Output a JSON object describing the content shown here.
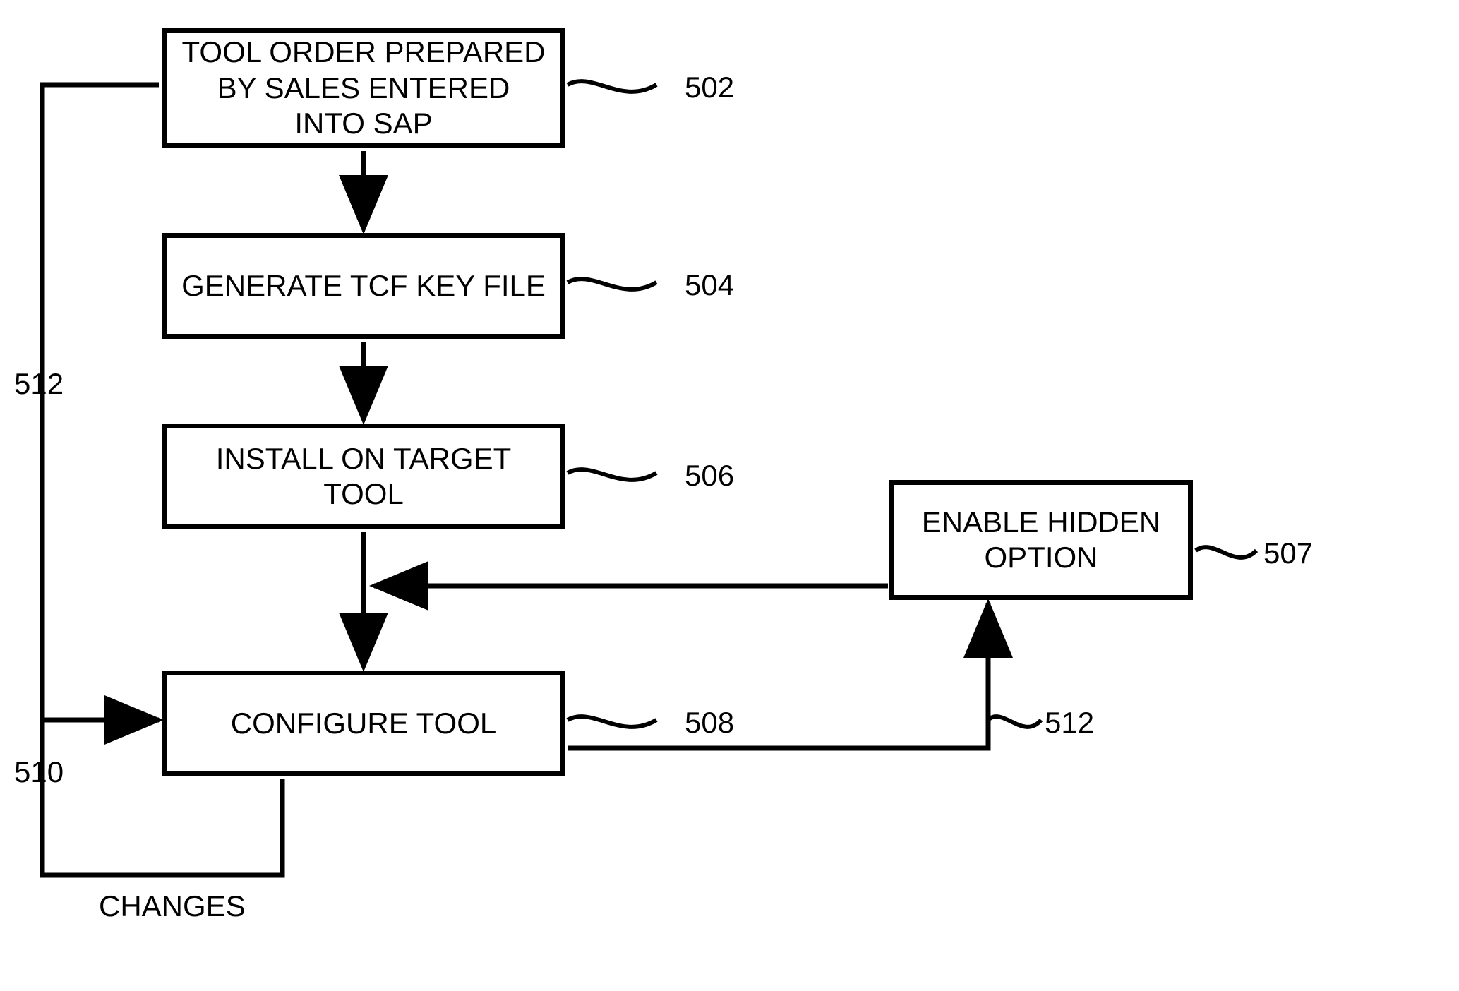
{
  "boxes": {
    "b502": "TOOL ORDER PREPARED BY SALES ENTERED INTO SAP",
    "b504": "GENERATE TCF KEY FILE",
    "b506": "INSTALL ON TARGET TOOL",
    "b508": "CONFIGURE TOOL",
    "b507": "ENABLE HIDDEN OPTION"
  },
  "labels": {
    "l502": "502",
    "l504": "504",
    "l506": "506",
    "l508": "508",
    "l507": "507",
    "l512a": "512",
    "l512b": "512",
    "l510": "510",
    "changes": "CHANGES"
  }
}
